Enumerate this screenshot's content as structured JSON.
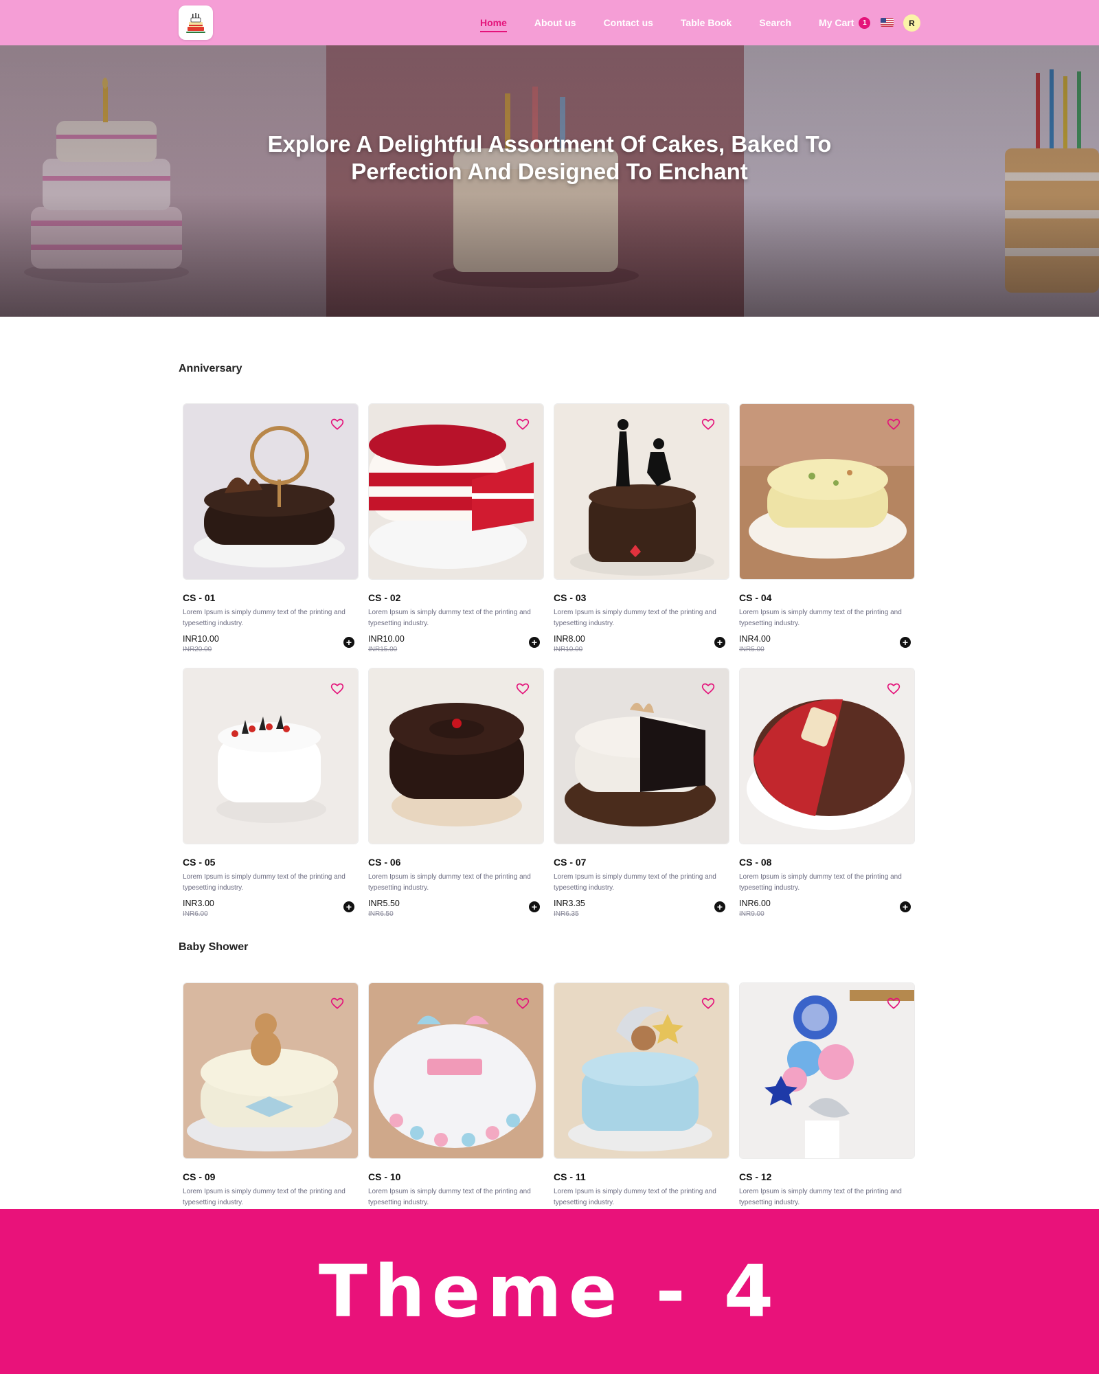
{
  "header": {
    "logo_icon": "cake-logo-icon",
    "nav": [
      {
        "label": "Home",
        "active": true
      },
      {
        "label": "About us",
        "active": false
      },
      {
        "label": "Contact us",
        "active": false
      },
      {
        "label": "Table Book",
        "active": false
      },
      {
        "label": "Search",
        "active": false
      }
    ],
    "cart": {
      "label": "My Cart",
      "count": "1"
    },
    "language_icon": "us-flag-icon",
    "avatar_initial": "R"
  },
  "hero": {
    "title": "Explore A Delightful Assortment Of Cakes, Baked To Perfection And Designed To Enchant"
  },
  "sections": [
    {
      "title": "Anniversary",
      "products": [
        {
          "name": "CS - 01",
          "desc": "Lorem Ipsum is simply dummy text of the printing and typesetting industry.",
          "price": "INR10.00",
          "old_price": "INR20.00"
        },
        {
          "name": "CS - 02",
          "desc": "Lorem Ipsum is simply dummy text of the printing and typesetting industry.",
          "price": "INR10.00",
          "old_price": "INR15.00"
        },
        {
          "name": "CS - 03",
          "desc": "Lorem Ipsum is simply dummy text of the printing and typesetting industry.",
          "price": "INR8.00",
          "old_price": "INR10.00"
        },
        {
          "name": "CS - 04",
          "desc": "Lorem Ipsum is simply dummy text of the printing and typesetting industry.",
          "price": "INR4.00",
          "old_price": "INR5.00"
        },
        {
          "name": "CS - 05",
          "desc": "Lorem Ipsum is simply dummy text of the printing and typesetting industry.",
          "price": "INR3.00",
          "old_price": "INR6.00"
        },
        {
          "name": "CS - 06",
          "desc": "Lorem Ipsum is simply dummy text of the printing and typesetting industry.",
          "price": "INR5.50",
          "old_price": "INR6.50"
        },
        {
          "name": "CS - 07",
          "desc": "Lorem Ipsum is simply dummy text of the printing and typesetting industry.",
          "price": "INR3.35",
          "old_price": "INR6.35"
        },
        {
          "name": "CS - 08",
          "desc": "Lorem Ipsum is simply dummy text of the printing and typesetting industry.",
          "price": "INR6.00",
          "old_price": "INR9.00"
        }
      ]
    },
    {
      "title": "Baby Shower",
      "products": [
        {
          "name": "CS - 09",
          "desc": "Lorem Ipsum is simply dummy text of the printing and typesetting industry."
        },
        {
          "name": "CS - 10",
          "desc": "Lorem Ipsum is simply dummy text of the printing and typesetting industry."
        },
        {
          "name": "CS - 11",
          "desc": "Lorem Ipsum is simply dummy text of the printing and typesetting industry."
        },
        {
          "name": "CS - 12",
          "desc": "Lorem Ipsum is simply dummy text of the printing and typesetting industry."
        }
      ]
    }
  ],
  "icons": {
    "favorite": "heart-outline-icon",
    "add_to_cart": "plus-circle-icon"
  },
  "banner": {
    "text": "Theme - 4"
  },
  "colors": {
    "navbar": "#f59ed6",
    "accent": "#e4137a",
    "banner": "#e9127a"
  }
}
